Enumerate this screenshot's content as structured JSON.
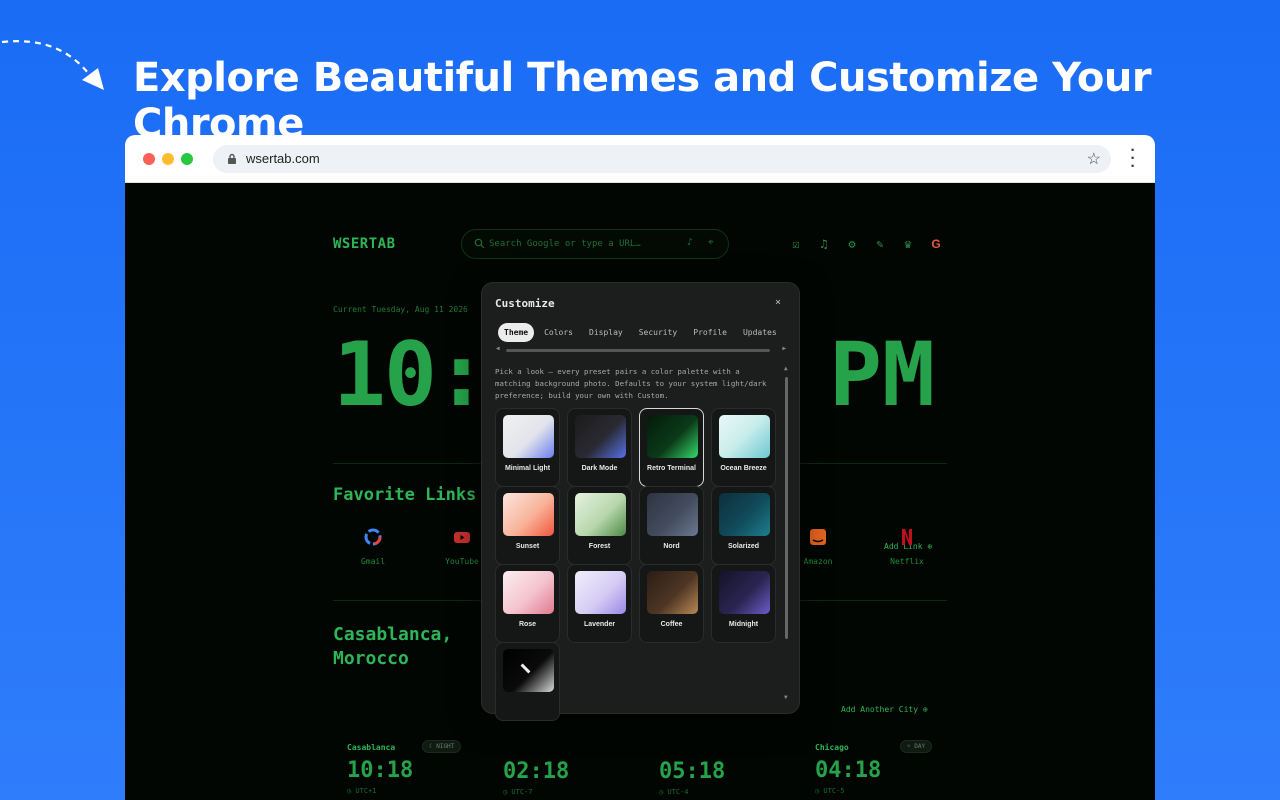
{
  "headline": "Explore Beautiful Themes and Customize Your Chrome",
  "browser": {
    "url": "wsertab.com"
  },
  "app": {
    "brand": "WSERTAB",
    "search_placeholder": "Search Google or type a URL…",
    "date": "Current Tuesday, Aug 11 2026",
    "clock_left": "10:",
    "clock_ampm": "PM"
  },
  "favorites": {
    "title": "Favorite Links",
    "add_label": "Add Link ⊕",
    "items": [
      {
        "label": "Gmail",
        "icon": "google-icon",
        "color": "#4285f4"
      },
      {
        "label": "YouTube",
        "icon": "youtube-icon",
        "color": "#c4302b"
      },
      {
        "label": "Amazon",
        "icon": "amazon-icon",
        "color": "#e5641f"
      },
      {
        "label": "Netflix",
        "icon": "netflix-icon",
        "color": "#c20f1b"
      }
    ]
  },
  "world_clock": {
    "title": "Casablanca, Morocco",
    "add_label": "Add Another City ⊕",
    "cities": [
      {
        "name": "Casablanca",
        "badge": "☾ NIGHT",
        "time": "10:18",
        "tz": "◷ UTC+1"
      },
      {
        "name": "",
        "badge": "",
        "time": "02:18",
        "tz": "◷ UTC-7"
      },
      {
        "name": "",
        "badge": "",
        "time": "05:18",
        "tz": "◷ UTC-4"
      },
      {
        "name": "Chicago",
        "badge": "☼ DAY",
        "time": "04:18",
        "tz": "◷ UTC-5"
      }
    ]
  },
  "customize": {
    "title": "Customize",
    "close": "×",
    "tabs": [
      "Theme",
      "Colors",
      "Display",
      "Security",
      "Profile",
      "Updates"
    ],
    "active_tab": "Theme",
    "description": "Pick a look — every preset pairs a color palette with a matching background photo. Defaults to your system light/dark preference; build your own with Custom.",
    "themes": [
      {
        "name": "Minimal Light",
        "gradient": "linear-gradient(135deg,#f1f1f1 0%,#e2e4ea 55%,#6a7ef0 100%)",
        "active": false
      },
      {
        "name": "Dark Mode",
        "gradient": "linear-gradient(135deg,#1b1b1b 0%,#2a2a33 55%,#5572e8 100%)",
        "active": false
      },
      {
        "name": "Retro Terminal",
        "gradient": "linear-gradient(135deg,#041a0a 0%,#0a3a18 55%,#36d96a 100%)",
        "active": true
      },
      {
        "name": "Ocean Breeze",
        "gradient": "linear-gradient(135deg,#eaf8f7 0%,#c8ecec 50%,#6cc8d2 100%)",
        "active": false
      },
      {
        "name": "Sunset",
        "gradient": "linear-gradient(135deg,#fde6dd 0%,#f8b39a 55%,#f0553d 100%)",
        "active": false
      },
      {
        "name": "Forest",
        "gradient": "linear-gradient(135deg,#e6f2e1 0%,#b8d7ad 55%,#4c8a44 100%)",
        "active": false
      },
      {
        "name": "Nord",
        "gradient": "linear-gradient(135deg,#2e3440 0%,#434c5e 55%,#6b7891 100%)",
        "active": false
      },
      {
        "name": "Solarized",
        "gradient": "linear-gradient(135deg,#0d2f3a 0%,#114b5a 55%,#1d7f90 100%)",
        "active": false
      },
      {
        "name": "Rose",
        "gradient": "linear-gradient(135deg,#fdeef1 0%,#f4c3cd 55%,#e07a8f 100%)",
        "active": false
      },
      {
        "name": "Lavender",
        "gradient": "linear-gradient(135deg,#f1eefb 0%,#d6cdf4 55%,#9b87e6 100%)",
        "active": false
      },
      {
        "name": "Coffee",
        "gradient": "linear-gradient(135deg,#2a1d14 0%,#4e3624 55%,#b98955 100%)",
        "active": false
      },
      {
        "name": "Midnight",
        "gradient": "linear-gradient(135deg,#14122a 0%,#2a2550 55%,#6b5cc9 100%)",
        "active": false
      },
      {
        "name": "",
        "gradient": "linear-gradient(135deg,#000000 0%,#0a0a0a 55%,#d9d9d9 100%)",
        "active": false
      }
    ]
  }
}
